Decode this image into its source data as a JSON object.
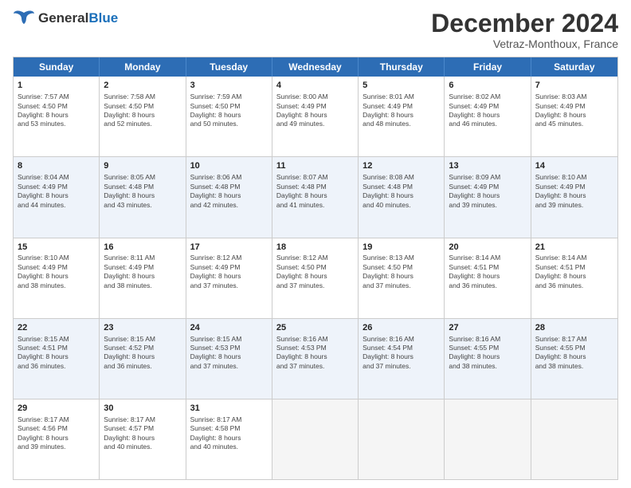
{
  "logo": {
    "text_general": "General",
    "text_blue": "Blue"
  },
  "title": "December 2024",
  "location": "Vetraz-Monthoux, France",
  "header_days": [
    "Sunday",
    "Monday",
    "Tuesday",
    "Wednesday",
    "Thursday",
    "Friday",
    "Saturday"
  ],
  "rows": [
    {
      "alt": false,
      "cells": [
        {
          "day": "1",
          "info": "Sunrise: 7:57 AM\nSunset: 4:50 PM\nDaylight: 8 hours\nand 53 minutes."
        },
        {
          "day": "2",
          "info": "Sunrise: 7:58 AM\nSunset: 4:50 PM\nDaylight: 8 hours\nand 52 minutes."
        },
        {
          "day": "3",
          "info": "Sunrise: 7:59 AM\nSunset: 4:50 PM\nDaylight: 8 hours\nand 50 minutes."
        },
        {
          "day": "4",
          "info": "Sunrise: 8:00 AM\nSunset: 4:49 PM\nDaylight: 8 hours\nand 49 minutes."
        },
        {
          "day": "5",
          "info": "Sunrise: 8:01 AM\nSunset: 4:49 PM\nDaylight: 8 hours\nand 48 minutes."
        },
        {
          "day": "6",
          "info": "Sunrise: 8:02 AM\nSunset: 4:49 PM\nDaylight: 8 hours\nand 46 minutes."
        },
        {
          "day": "7",
          "info": "Sunrise: 8:03 AM\nSunset: 4:49 PM\nDaylight: 8 hours\nand 45 minutes."
        }
      ]
    },
    {
      "alt": true,
      "cells": [
        {
          "day": "8",
          "info": "Sunrise: 8:04 AM\nSunset: 4:49 PM\nDaylight: 8 hours\nand 44 minutes."
        },
        {
          "day": "9",
          "info": "Sunrise: 8:05 AM\nSunset: 4:48 PM\nDaylight: 8 hours\nand 43 minutes."
        },
        {
          "day": "10",
          "info": "Sunrise: 8:06 AM\nSunset: 4:48 PM\nDaylight: 8 hours\nand 42 minutes."
        },
        {
          "day": "11",
          "info": "Sunrise: 8:07 AM\nSunset: 4:48 PM\nDaylight: 8 hours\nand 41 minutes."
        },
        {
          "day": "12",
          "info": "Sunrise: 8:08 AM\nSunset: 4:48 PM\nDaylight: 8 hours\nand 40 minutes."
        },
        {
          "day": "13",
          "info": "Sunrise: 8:09 AM\nSunset: 4:49 PM\nDaylight: 8 hours\nand 39 minutes."
        },
        {
          "day": "14",
          "info": "Sunrise: 8:10 AM\nSunset: 4:49 PM\nDaylight: 8 hours\nand 39 minutes."
        }
      ]
    },
    {
      "alt": false,
      "cells": [
        {
          "day": "15",
          "info": "Sunrise: 8:10 AM\nSunset: 4:49 PM\nDaylight: 8 hours\nand 38 minutes."
        },
        {
          "day": "16",
          "info": "Sunrise: 8:11 AM\nSunset: 4:49 PM\nDaylight: 8 hours\nand 38 minutes."
        },
        {
          "day": "17",
          "info": "Sunrise: 8:12 AM\nSunset: 4:49 PM\nDaylight: 8 hours\nand 37 minutes."
        },
        {
          "day": "18",
          "info": "Sunrise: 8:12 AM\nSunset: 4:50 PM\nDaylight: 8 hours\nand 37 minutes."
        },
        {
          "day": "19",
          "info": "Sunrise: 8:13 AM\nSunset: 4:50 PM\nDaylight: 8 hours\nand 37 minutes."
        },
        {
          "day": "20",
          "info": "Sunrise: 8:14 AM\nSunset: 4:51 PM\nDaylight: 8 hours\nand 36 minutes."
        },
        {
          "day": "21",
          "info": "Sunrise: 8:14 AM\nSunset: 4:51 PM\nDaylight: 8 hours\nand 36 minutes."
        }
      ]
    },
    {
      "alt": true,
      "cells": [
        {
          "day": "22",
          "info": "Sunrise: 8:15 AM\nSunset: 4:51 PM\nDaylight: 8 hours\nand 36 minutes."
        },
        {
          "day": "23",
          "info": "Sunrise: 8:15 AM\nSunset: 4:52 PM\nDaylight: 8 hours\nand 36 minutes."
        },
        {
          "day": "24",
          "info": "Sunrise: 8:15 AM\nSunset: 4:53 PM\nDaylight: 8 hours\nand 37 minutes."
        },
        {
          "day": "25",
          "info": "Sunrise: 8:16 AM\nSunset: 4:53 PM\nDaylight: 8 hours\nand 37 minutes."
        },
        {
          "day": "26",
          "info": "Sunrise: 8:16 AM\nSunset: 4:54 PM\nDaylight: 8 hours\nand 37 minutes."
        },
        {
          "day": "27",
          "info": "Sunrise: 8:16 AM\nSunset: 4:55 PM\nDaylight: 8 hours\nand 38 minutes."
        },
        {
          "day": "28",
          "info": "Sunrise: 8:17 AM\nSunset: 4:55 PM\nDaylight: 8 hours\nand 38 minutes."
        }
      ]
    },
    {
      "alt": false,
      "cells": [
        {
          "day": "29",
          "info": "Sunrise: 8:17 AM\nSunset: 4:56 PM\nDaylight: 8 hours\nand 39 minutes."
        },
        {
          "day": "30",
          "info": "Sunrise: 8:17 AM\nSunset: 4:57 PM\nDaylight: 8 hours\nand 40 minutes."
        },
        {
          "day": "31",
          "info": "Sunrise: 8:17 AM\nSunset: 4:58 PM\nDaylight: 8 hours\nand 40 minutes."
        },
        {
          "day": "",
          "info": ""
        },
        {
          "day": "",
          "info": ""
        },
        {
          "day": "",
          "info": ""
        },
        {
          "day": "",
          "info": ""
        }
      ]
    }
  ]
}
